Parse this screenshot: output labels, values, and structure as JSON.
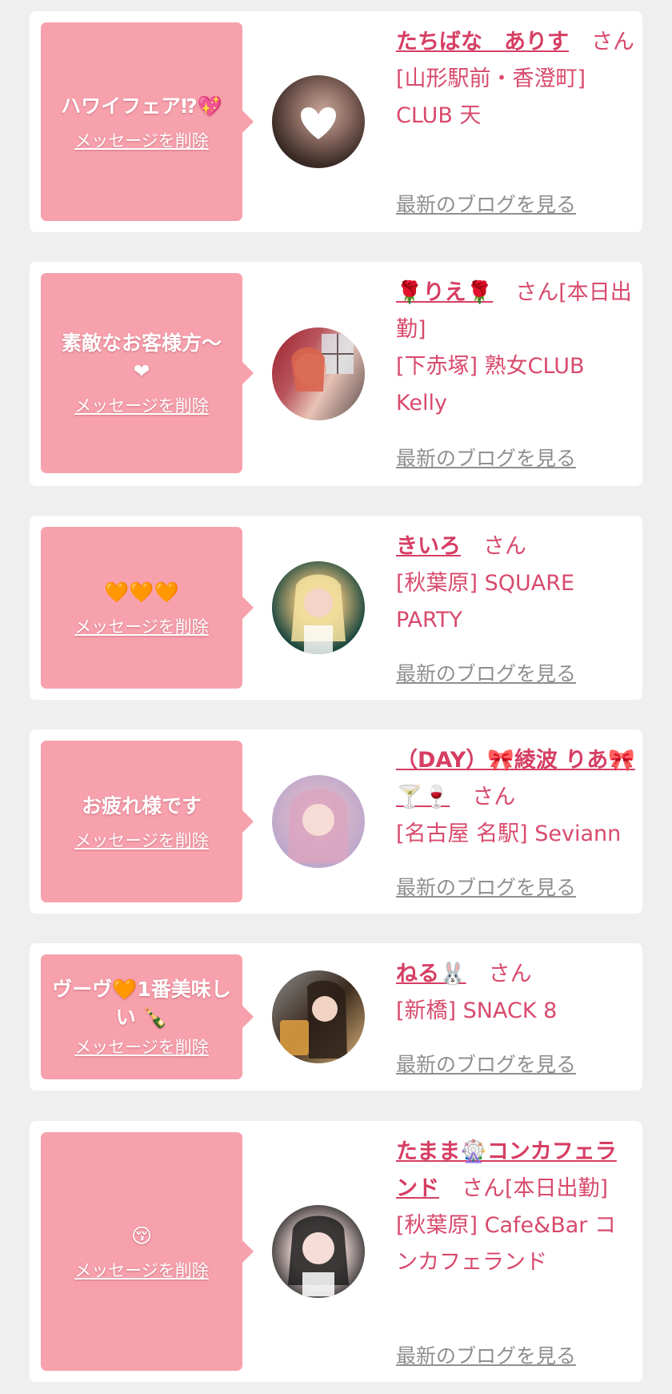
{
  "cards": [
    {
      "message": "ハワイフェア⁉💖",
      "delete_label": "メッセージを削除",
      "name": "たちばな　ありす",
      "suffix": "さん",
      "shop": "[山形駅前・香澄町] CLUB 天",
      "blog_label": "最新のブログを見る",
      "avatar_colors": [
        "#3a2a25",
        "#c9a79a"
      ]
    },
    {
      "message": "素敵なお客様方〜 ❤",
      "delete_label": "メッセージを削除",
      "name": "🌹りえ🌹",
      "suffix": "さん[本日出勤]",
      "shop": "[下赤塚] 熟女CLUB Kelly",
      "blog_label": "最新のブログを見る",
      "avatar_colors": [
        "#9b1f2a",
        "#e8c3b6"
      ]
    },
    {
      "message": "🧡🧡🧡",
      "delete_label": "メッセージを削除",
      "name": "きいろ",
      "suffix": "さん",
      "shop": "[秋葉原] SQUARE PARTY",
      "blog_label": "最新のブログを見る",
      "avatar_colors": [
        "#1f4a40",
        "#f2dc8e"
      ]
    },
    {
      "message": "お疲れ様です",
      "delete_label": "メッセージを削除",
      "name": "（DAY）🎀綾波 りあ🎀🍸🍷",
      "suffix": "さん",
      "shop": "[名古屋 名駅] Seviann",
      "blog_label": "最新のブログを見る",
      "avatar_colors": [
        "#c7b4d8",
        "#e7c8cf"
      ]
    },
    {
      "message": "ヴーヴ🧡1番美味しい 🍾",
      "delete_label": "メッセージを削除",
      "name": "ねる🐰",
      "suffix": "さん",
      "shop": "[新橋] SNACK 8",
      "blog_label": "最新のブログを見る",
      "avatar_colors": [
        "#3b2a1e",
        "#d9b27a"
      ]
    },
    {
      "message": "😚",
      "delete_label": "メッセージを削除",
      "name": "たまま🎡コンカフェランド",
      "suffix": "さん[本日出勤]",
      "shop": "[秋葉原] Cafe&Bar コンカフェランド",
      "blog_label": "最新のブログを見る",
      "avatar_colors": [
        "#2a2a2a",
        "#f1d9d4"
      ]
    }
  ]
}
